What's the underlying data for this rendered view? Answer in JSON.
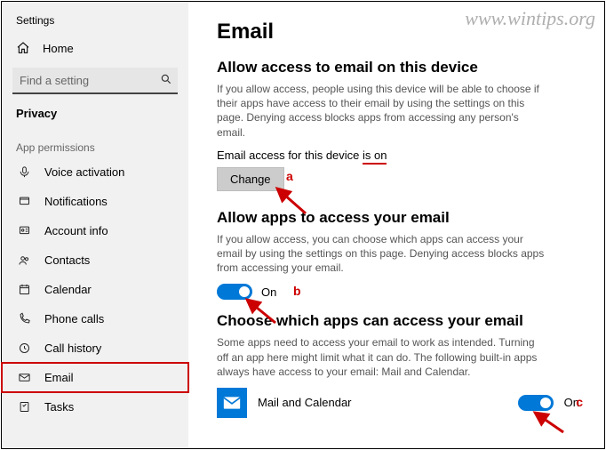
{
  "watermark": "www.wintips.org",
  "app_title": "Settings",
  "home_label": "Home",
  "search": {
    "placeholder": "Find a setting"
  },
  "category_header": "Privacy",
  "group_label": "App permissions",
  "sidebar": {
    "items": [
      {
        "label": "Voice activation"
      },
      {
        "label": "Notifications"
      },
      {
        "label": "Account info"
      },
      {
        "label": "Contacts"
      },
      {
        "label": "Calendar"
      },
      {
        "label": "Phone calls"
      },
      {
        "label": "Call history"
      },
      {
        "label": "Email"
      },
      {
        "label": "Tasks"
      }
    ]
  },
  "main": {
    "title": "Email",
    "sec1": {
      "title": "Allow access to email on this device",
      "desc": "If you allow access, people using this device will be able to choose if their apps have access to their email by using the settings on this page. Denying access blocks apps from accessing any person's email.",
      "status_prefix": "Email access for this device ",
      "status_value": "is on",
      "change_btn": "Change"
    },
    "sec2": {
      "title": "Allow apps to access your email",
      "desc": "If you allow access, you can choose which apps can access your email by using the settings on this page. Denying access blocks apps from accessing your email.",
      "toggle_label": "On"
    },
    "sec3": {
      "title": "Choose which apps can access your email",
      "desc": "Some apps need to access your email to work as intended. Turning off an app here might limit what it can do. The following built-in apps always have access to your email: Mail and Calendar.",
      "app_name": "Mail and Calendar",
      "toggle_label": "On"
    }
  },
  "annotations": {
    "a": "a",
    "b": "b",
    "c": "c"
  },
  "colors": {
    "accent": "#0078d7",
    "anno": "#c00"
  }
}
